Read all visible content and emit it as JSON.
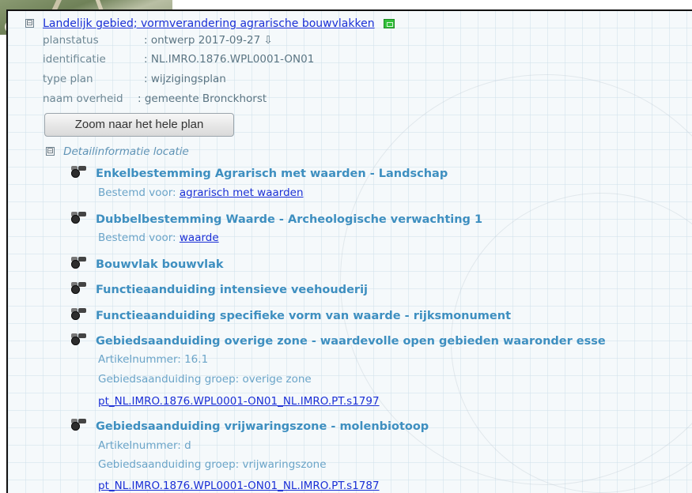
{
  "plan": {
    "title": "Landelijk gebied; vormverandering agrarische bouwvlakken",
    "toggle": "⊟",
    "meta": [
      {
        "key": "planstatus",
        "value": ": ontwerp 2017-09-27 ⇩"
      },
      {
        "key": "identificatie",
        "value": ": NL.IMRO.1876.WPL0001-ON01"
      },
      {
        "key": "type plan",
        "value": ": wijzigingsplan"
      },
      {
        "key": "naam overheid",
        "value": ": gemeente Bronckhorst"
      }
    ],
    "zoom_button": "Zoom naar het hele plan"
  },
  "detail": {
    "title": "Detailinformatie locatie",
    "toggle": "⊟",
    "items": [
      {
        "title": "Enkelbestemming Agrarisch met waarden - Landschap",
        "sub_label": "Bestemd voor: ",
        "sub_link": "agrarisch met waarden"
      },
      {
        "title": "Dubbelbestemming Waarde - Archeologische verwachting 1",
        "sub_label": "Bestemd voor: ",
        "sub_link": "waarde"
      },
      {
        "title": "Bouwvlak bouwvlak"
      },
      {
        "title": "Functieaanduiding intensieve veehouderij"
      },
      {
        "title": "Functieaanduiding specifieke vorm van waarde - rijksmonument"
      },
      {
        "title": "Gebiedsaanduiding overige zone - waardevolle open gebieden waaronder esse",
        "artikel": "Artikelnummer: 16.1",
        "groep": "Gebiedsaanduiding groep: overige zone",
        "link": "pt_NL.IMRO.1876.WPL0001-ON01_NL.IMRO.PT.s1797"
      },
      {
        "title": "Gebiedsaanduiding vrijwaringszone - molenbiotoop",
        "artikel": "Artikelnummer: d",
        "groep": "Gebiedsaanduiding groep: vrijwaringszone",
        "link": "pt_NL.IMRO.1876.WPL0001-ON01_NL.IMRO.PT.s1787"
      }
    ]
  },
  "colors": {
    "link": "#1a2fd6",
    "item_title": "#3e8fc0",
    "meta_text": "#6d8794",
    "panel_bg": "#f5f9fb"
  }
}
